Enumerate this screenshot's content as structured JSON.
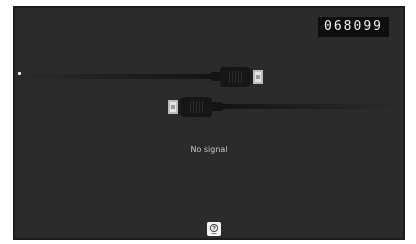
{
  "signal": {
    "id_code": "068099",
    "message": "No signal"
  },
  "icons": {
    "cable_top": "hdmi-cable-icon",
    "cable_bottom": "hdmi-cable-icon",
    "help": "help-question-icon"
  },
  "colors": {
    "background": "#2b2b2b",
    "frame": "#1c1c1c",
    "code_box": "#0e0e0e",
    "text": "#c9c9c9"
  }
}
